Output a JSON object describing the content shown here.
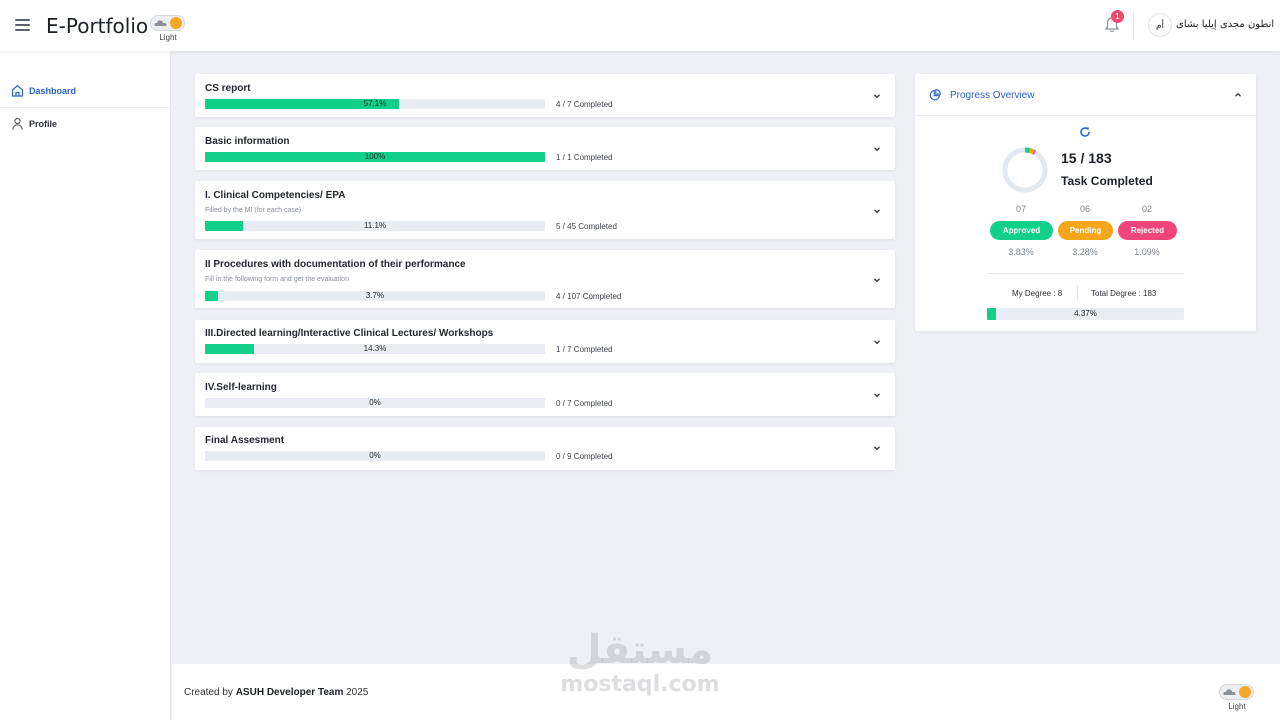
{
  "header": {
    "brand": "E-Portfolio",
    "theme_label": "Light",
    "notification_count": "1",
    "user_initials": "أم",
    "user_name": "انطون مجدى إيليا بشاى"
  },
  "sidebar": {
    "items": [
      {
        "label": "Dashboard",
        "icon": "home-icon",
        "active": true
      },
      {
        "label": "Profile",
        "icon": "user-icon",
        "active": false
      }
    ]
  },
  "sections": [
    {
      "title": "CS report",
      "subtitle": "",
      "progress": 57.1,
      "percent_label": "57.1%",
      "completed": "4 / 7 Completed"
    },
    {
      "title": "Basic information",
      "subtitle": "",
      "progress": 100,
      "percent_label": "100%",
      "completed": "1 / 1 Completed"
    },
    {
      "title": "I. Clinical Competencies/ EPA",
      "subtitle": "Filled by the MI (for each case)",
      "progress": 11.1,
      "percent_label": "11.1%",
      "completed": "5 / 45 Completed"
    },
    {
      "title": "II Procedures with documentation of their performance",
      "subtitle": "Fill in the following form and get the evaluation",
      "progress": 3.7,
      "percent_label": "3.7%",
      "completed": "4 / 107 Completed"
    },
    {
      "title": "III.Directed learning/Interactive Clinical Lectures/ Workshops",
      "subtitle": "",
      "progress": 14.3,
      "percent_label": "14.3%",
      "completed": "1 / 7 Completed"
    },
    {
      "title": "IV.Self-learning",
      "subtitle": "",
      "progress": 0,
      "percent_label": "0%",
      "completed": "0 / 7 Completed"
    },
    {
      "title": "Final Assesment",
      "subtitle": "",
      "progress": 0,
      "percent_label": "0%",
      "completed": "0 / 9 Completed"
    }
  ],
  "overview": {
    "title": "Progress Overview",
    "count": "15 / 183",
    "count_label": "Task Completed",
    "stats": [
      {
        "count": "07",
        "label": "Approved",
        "percent": "3.83%",
        "color": "#12cf8a"
      },
      {
        "count": "06",
        "label": "Pending",
        "percent": "3.28%",
        "color": "#f6a61b"
      },
      {
        "count": "02",
        "label": "Rejected",
        "percent": "1.09%",
        "color": "#f0457a"
      }
    ],
    "my_degree": "My Degree : 8",
    "total_degree": "Total Degree : 183",
    "degree_progress": 4.37,
    "degree_percent_label": "4.37%"
  },
  "footer": {
    "prefix": "Created by ",
    "team": "ASUH Developer Team",
    "year": " 2025",
    "theme_label": "Light"
  },
  "watermark": {
    "arabic": "مستقل",
    "latin": "mostaql.com"
  },
  "colors": {
    "accent": "#2b62c8",
    "progress": "#12cf8a",
    "badge": "#ef4a6f"
  }
}
